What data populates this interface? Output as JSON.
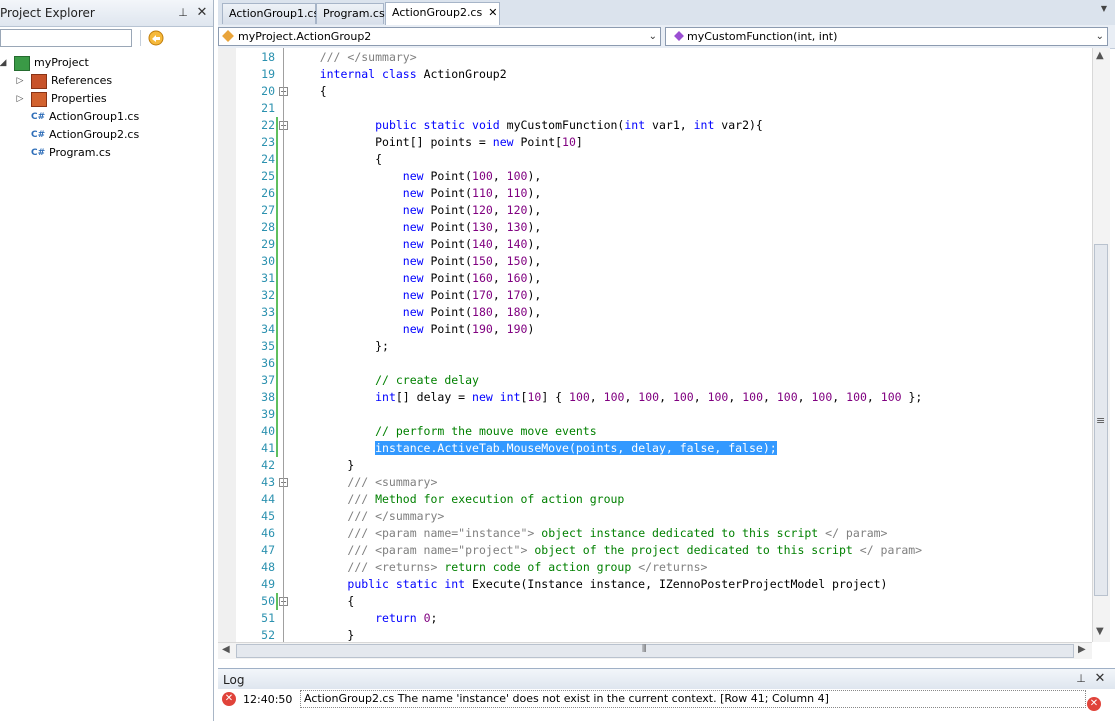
{
  "explorer": {
    "title": "Project Explorer",
    "search_value": "",
    "project": "myProject",
    "items": [
      {
        "label": "References"
      },
      {
        "label": "Properties"
      },
      {
        "label": "ActionGroup1.cs"
      },
      {
        "label": "ActionGroup2.cs"
      },
      {
        "label": "Program.cs"
      }
    ]
  },
  "tabs": [
    "ActionGroup1.cs",
    "Program.cs",
    "ActionGroup2.cs"
  ],
  "active_tab": "ActionGroup2.cs",
  "nav": {
    "class_select": "myProject.ActionGroup2",
    "member_select": "myCustomFunction(int, int)"
  },
  "code_lines": [
    {
      "n": "18",
      "html": "    <span class=\"dc\">/// &lt;/summary&gt;</span>"
    },
    {
      "n": "19",
      "html": "    <span class=\"kw\">internal class</span> ActionGroup2"
    },
    {
      "n": "20",
      "html": "    {"
    },
    {
      "n": "21",
      "html": ""
    },
    {
      "n": "22",
      "html": "            <span class=\"kw\">public static void</span> myCustomFunction(<span class=\"kw\">int</span> var1, <span class=\"kw\">int</span> var2){"
    },
    {
      "n": "23",
      "html": "            Point[] points = <span class=\"kw\">new</span> Point[<span class=\"num\">10</span>]"
    },
    {
      "n": "24",
      "html": "            {"
    },
    {
      "n": "25",
      "html": "                <span class=\"kw\">new</span> Point(<span class=\"num\">100</span>, <span class=\"num\">100</span>),"
    },
    {
      "n": "26",
      "html": "                <span class=\"kw\">new</span> Point(<span class=\"num\">110</span>, <span class=\"num\">110</span>),"
    },
    {
      "n": "27",
      "html": "                <span class=\"kw\">new</span> Point(<span class=\"num\">120</span>, <span class=\"num\">120</span>),"
    },
    {
      "n": "28",
      "html": "                <span class=\"kw\">new</span> Point(<span class=\"num\">130</span>, <span class=\"num\">130</span>),"
    },
    {
      "n": "29",
      "html": "                <span class=\"kw\">new</span> Point(<span class=\"num\">140</span>, <span class=\"num\">140</span>),"
    },
    {
      "n": "30",
      "html": "                <span class=\"kw\">new</span> Point(<span class=\"num\">150</span>, <span class=\"num\">150</span>),"
    },
    {
      "n": "31",
      "html": "                <span class=\"kw\">new</span> Point(<span class=\"num\">160</span>, <span class=\"num\">160</span>),"
    },
    {
      "n": "32",
      "html": "                <span class=\"kw\">new</span> Point(<span class=\"num\">170</span>, <span class=\"num\">170</span>),"
    },
    {
      "n": "33",
      "html": "                <span class=\"kw\">new</span> Point(<span class=\"num\">180</span>, <span class=\"num\">180</span>),"
    },
    {
      "n": "34",
      "html": "                <span class=\"kw\">new</span> Point(<span class=\"num\">190</span>, <span class=\"num\">190</span>)"
    },
    {
      "n": "35",
      "html": "            };"
    },
    {
      "n": "36",
      "html": ""
    },
    {
      "n": "37",
      "html": "            <span class=\"cm\">// create delay</span>"
    },
    {
      "n": "38",
      "html": "            <span class=\"kw\">int</span>[] delay = <span class=\"kw\">new int</span>[<span class=\"num\">10</span>] { <span class=\"num\">100</span>, <span class=\"num\">100</span>, <span class=\"num\">100</span>, <span class=\"num\">100</span>, <span class=\"num\">100</span>, <span class=\"num\">100</span>, <span class=\"num\">100</span>, <span class=\"num\">100</span>, <span class=\"num\">100</span>, <span class=\"num\">100</span> };"
    },
    {
      "n": "39",
      "html": ""
    },
    {
      "n": "40",
      "html": "            <span class=\"cm\">// perform the mouve move events</span>"
    },
    {
      "n": "41",
      "html": "            <span class=\"sel\">instance.ActiveTab.MouseMove(points, delay, false, false);</span>"
    },
    {
      "n": "42",
      "html": "        }"
    },
    {
      "n": "43",
      "html": "        <span class=\"dc\">/// &lt;summary&gt;</span>"
    },
    {
      "n": "44",
      "html": "        <span class=\"dc\">///</span> <span class=\"cm\">Method for execution of action group</span>"
    },
    {
      "n": "45",
      "html": "        <span class=\"dc\">/// &lt;/summary&gt;</span>"
    },
    {
      "n": "46",
      "html": "        <span class=\"dc\">/// &lt;param name=\"instance\"&gt;</span> <span class=\"cm\">object instance dedicated to this script</span> <span class=\"dc\">&lt;/ param&gt;</span>"
    },
    {
      "n": "47",
      "html": "        <span class=\"dc\">/// &lt;param name=\"project\"&gt;</span> <span class=\"cm\">object of the project dedicated to this script</span> <span class=\"dc\">&lt;/ param&gt;</span>"
    },
    {
      "n": "48",
      "html": "        <span class=\"dc\">/// &lt;returns&gt;</span> <span class=\"cm\">return code of action group</span> <span class=\"dc\">&lt;/returns&gt;</span>"
    },
    {
      "n": "49",
      "html": "        <span class=\"kw\">public static int</span> Execute(Instance instance, IZennoPosterProjectModel project)"
    },
    {
      "n": "50",
      "html": "        {"
    },
    {
      "n": "51",
      "html": "            <span class=\"kw\">return</span> <span class=\"num\">0</span>;"
    },
    {
      "n": "52",
      "html": "        }"
    }
  ],
  "log": {
    "title": "Log",
    "time": "12:40:50",
    "message": "ActionGroup2.cs The name 'instance' does not exist in the current context. [Row 41; Column 4]"
  }
}
